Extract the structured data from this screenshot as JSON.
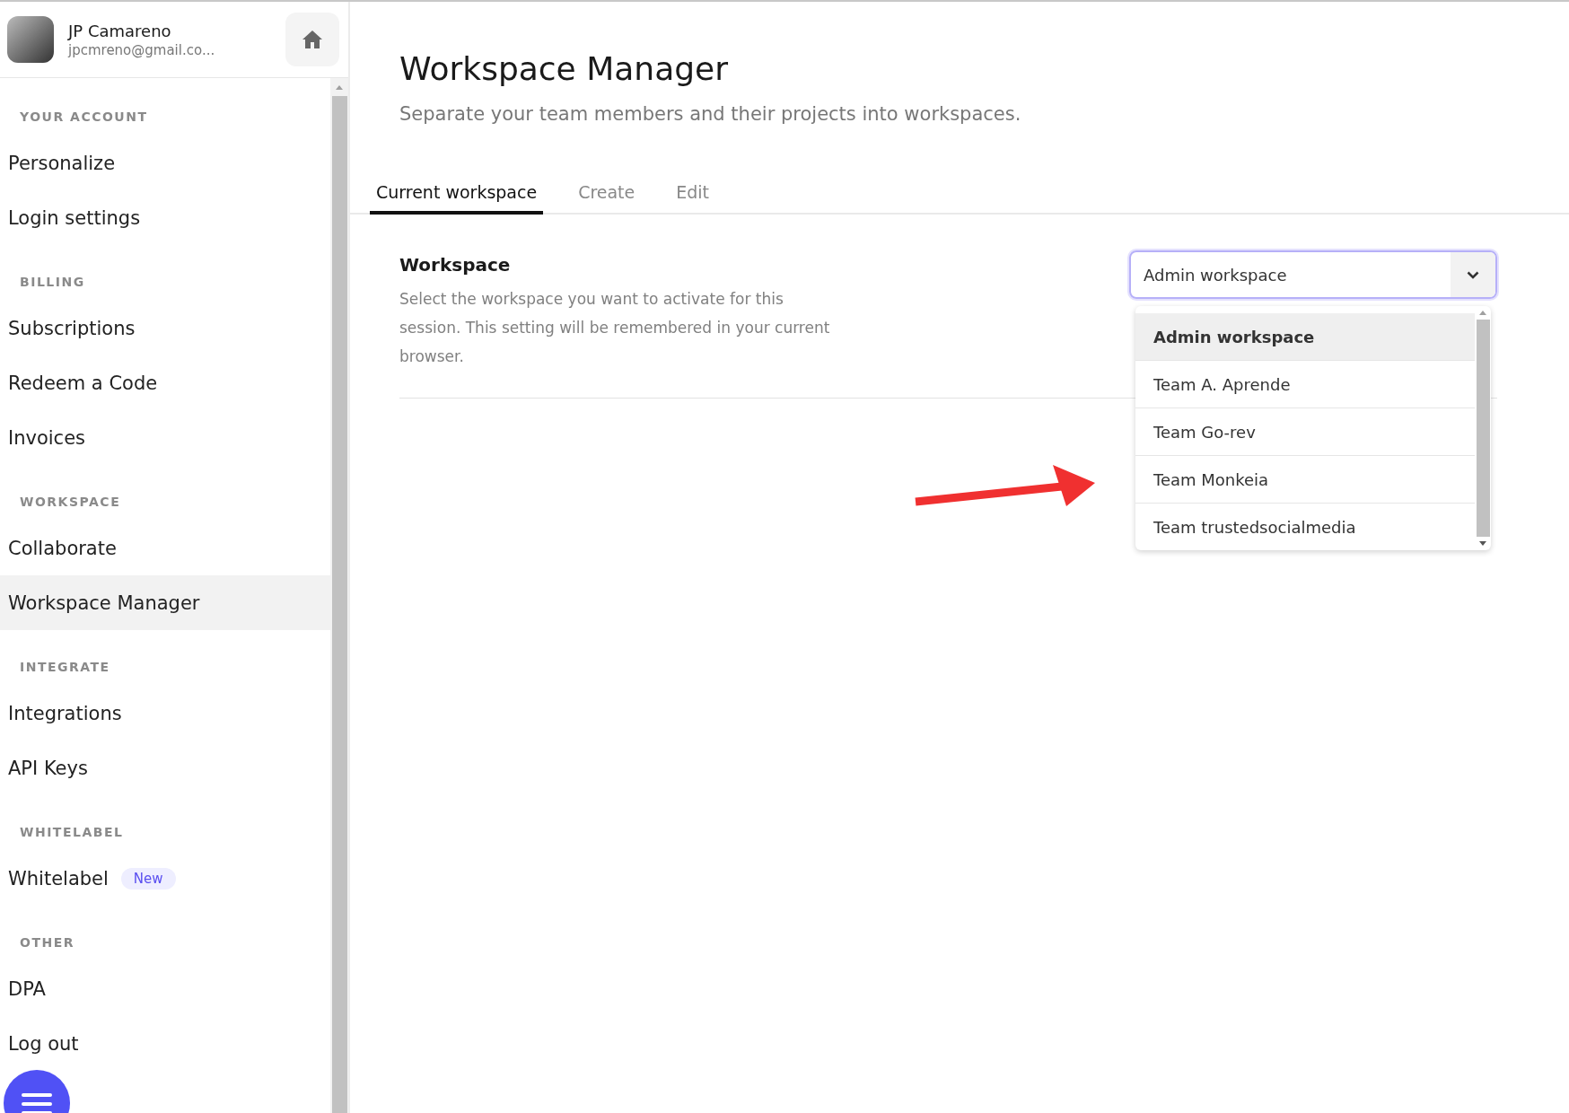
{
  "user": {
    "name": "JP Camareno",
    "email": "jpcmreno@gmail.co..."
  },
  "sidebar": {
    "sections": [
      {
        "title": "YOUR ACCOUNT",
        "items": [
          {
            "label": "Personalize",
            "selected": false
          },
          {
            "label": "Login settings",
            "selected": false
          }
        ]
      },
      {
        "title": "BILLING",
        "items": [
          {
            "label": "Subscriptions",
            "selected": false
          },
          {
            "label": "Redeem a Code",
            "selected": false
          },
          {
            "label": "Invoices",
            "selected": false
          }
        ]
      },
      {
        "title": "WORKSPACE",
        "items": [
          {
            "label": "Collaborate",
            "selected": false
          },
          {
            "label": "Workspace Manager",
            "selected": true
          }
        ]
      },
      {
        "title": "INTEGRATE",
        "items": [
          {
            "label": "Integrations",
            "selected": false
          },
          {
            "label": "API Keys",
            "selected": false
          }
        ]
      },
      {
        "title": "WHITELABEL",
        "items": [
          {
            "label": "Whitelabel",
            "selected": false,
            "badge": "New"
          }
        ]
      },
      {
        "title": "OTHER",
        "items": [
          {
            "label": "DPA",
            "selected": false
          },
          {
            "label": "Log out",
            "selected": false
          }
        ]
      }
    ]
  },
  "page": {
    "title": "Workspace Manager",
    "subtitle": "Separate your team members and their projects into workspaces."
  },
  "tabs": [
    {
      "label": "Current workspace",
      "selected": true
    },
    {
      "label": "Create",
      "selected": false
    },
    {
      "label": "Edit",
      "selected": false
    }
  ],
  "setting": {
    "label": "Workspace",
    "description": "Select the workspace you want to activate for this session. This setting will be remembered in your current browser.",
    "select": {
      "value": "Admin workspace",
      "expanded": true,
      "options": [
        {
          "label": "Admin workspace",
          "selected": true
        },
        {
          "label": "Team A. Aprende",
          "selected": false
        },
        {
          "label": "Team Go-rev",
          "selected": false
        },
        {
          "label": "Team Monkeia",
          "selected": false
        },
        {
          "label": "Team trustedsocialmedia",
          "selected": false
        }
      ]
    }
  }
}
